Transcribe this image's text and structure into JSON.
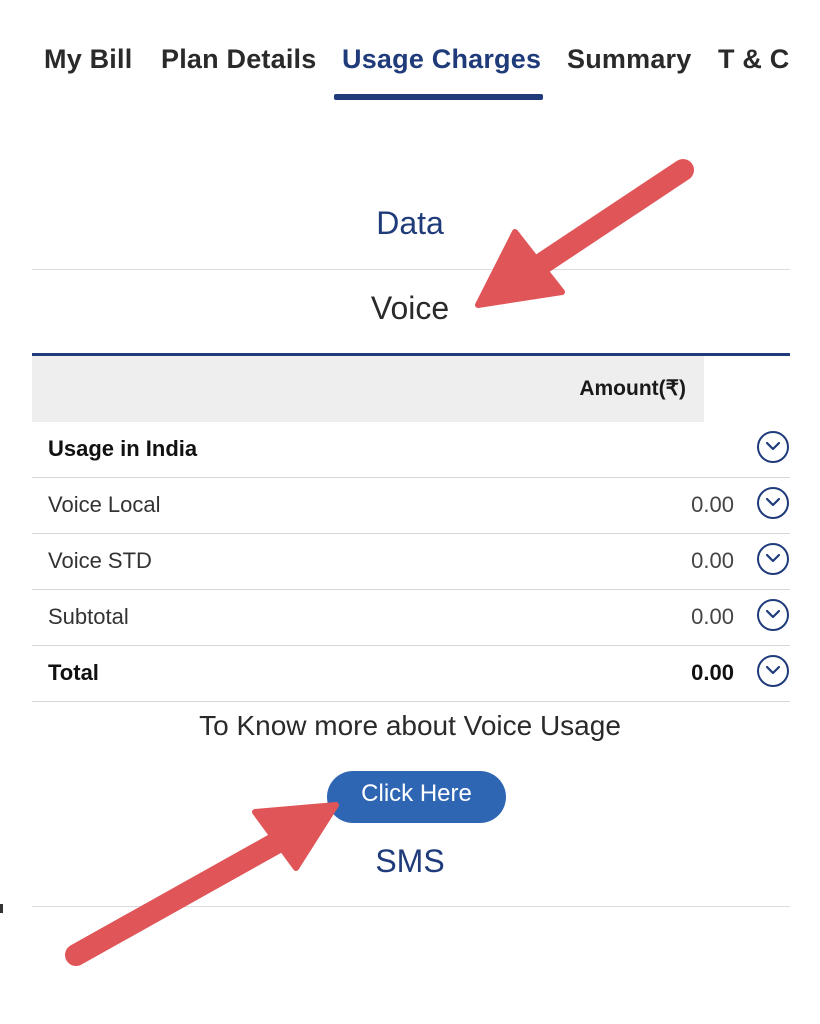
{
  "tabs": [
    {
      "label": "My Bill"
    },
    {
      "label": "Plan Details"
    },
    {
      "label": "Usage Charges",
      "active": true
    },
    {
      "label": "Summary"
    },
    {
      "label": "T & C"
    }
  ],
  "sections": {
    "data": "Data",
    "voice": "Voice",
    "sms": "SMS"
  },
  "table": {
    "amount_header": "Amount(₹)",
    "rows": [
      {
        "label": "Usage in India",
        "value": "",
        "bold": true
      },
      {
        "label": "Voice Local",
        "value": "0.00"
      },
      {
        "label": "Voice STD",
        "value": "0.00"
      },
      {
        "label": "Subtotal",
        "value": "0.00"
      },
      {
        "label": "Total",
        "value": "0.00",
        "bold": true
      }
    ]
  },
  "know_more": "To Know more about Voice Usage",
  "click_here": "Click Here",
  "colors": {
    "accent": "#1f3b7a",
    "button": "#2f66b3",
    "arrow": "#e05558",
    "header_bg": "#eeeeee"
  },
  "icons": [
    "chevron-down-circle-icon",
    "annotation-arrow"
  ]
}
